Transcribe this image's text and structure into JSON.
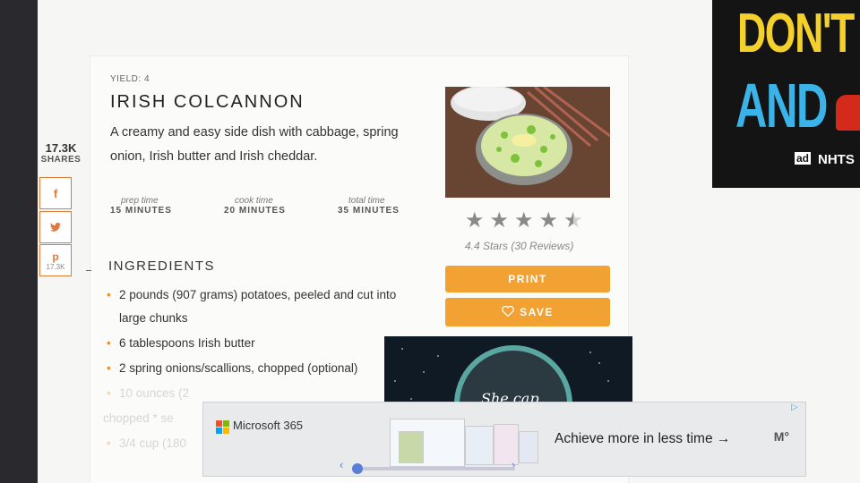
{
  "share": {
    "count": "17.3K",
    "label": "SHARES",
    "facebook_icon": "f",
    "twitter_icon": "twitter-icon",
    "pinterest_icon": "p",
    "pinterest_count": "17.3K"
  },
  "recipe": {
    "yield": "YIELD: 4",
    "title": "IRISH COLCANNON",
    "description": "A creamy and easy side dish with cabbage, spring onion, Irish butter and Irish cheddar.",
    "times": [
      {
        "label": "prep time",
        "value": "15 MINUTES"
      },
      {
        "label": "cook time",
        "value": "20 MINUTES"
      },
      {
        "label": "total time",
        "value": "35 MINUTES"
      }
    ],
    "rating": {
      "value": 4.4,
      "max": 5,
      "text": "4.4 Stars (30 Reviews)"
    },
    "print_label": "PRINT",
    "save_label": "SAVE",
    "ingredients_heading": "INGREDIENTS",
    "ingredients": [
      "2 pounds (907 grams) potatoes, peeled and cut into large chunks",
      "6 tablespoons Irish butter",
      "2 spring onions/scallions, chopped (optional)",
      "10 ounces (2",
      "chopped * se",
      "3/4 cup (180"
    ]
  },
  "ads": {
    "right": {
      "line1": "DON'T T",
      "line2": "AND",
      "ad_badge": "ad",
      "sponsor": "NHTS"
    },
    "middle": {
      "text": "She cap"
    },
    "bottom": {
      "brand": "Microsoft 365",
      "tagline": "Achieve more in less time →",
      "publisher_mark": "M°"
    }
  },
  "colors": {
    "accent": "#f2a232",
    "share": "#e07a3a"
  }
}
